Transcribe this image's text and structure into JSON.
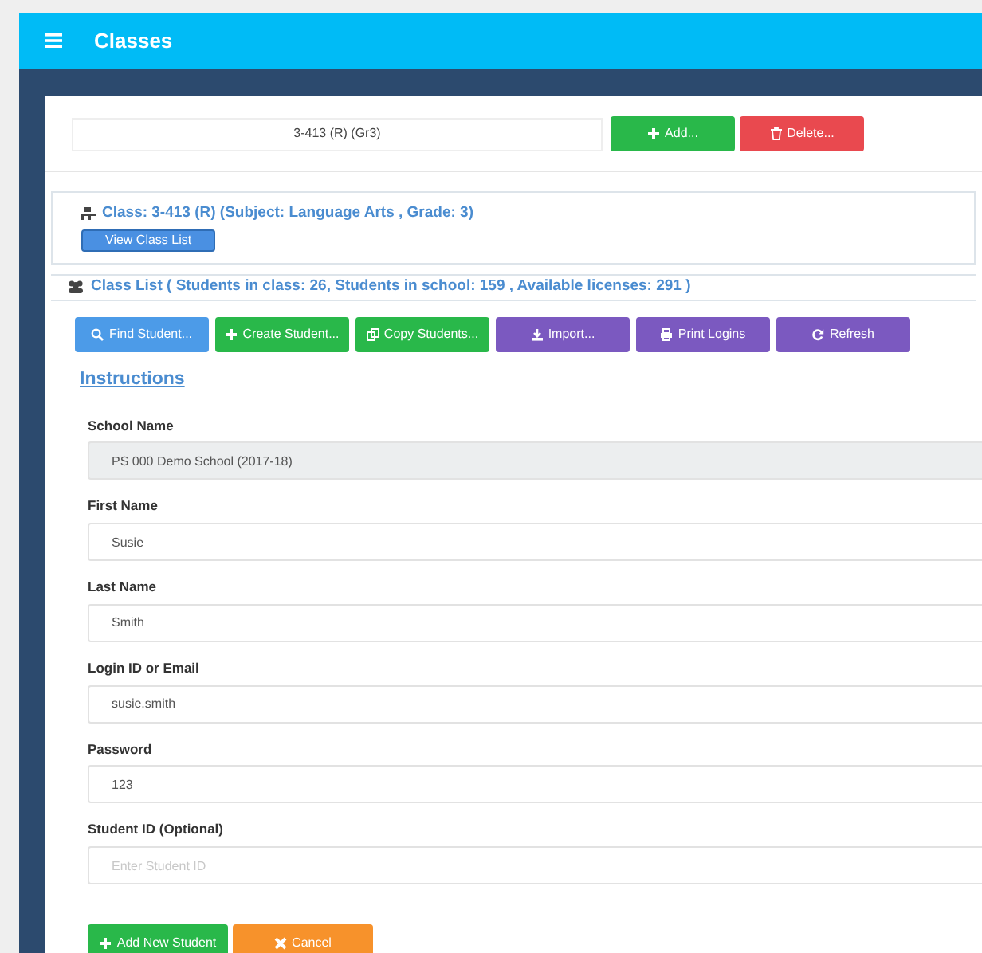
{
  "app_bar": {
    "title": "Classes"
  },
  "class_picker": {
    "value": "3-413 (R) (Gr3)",
    "buttons": [
      {
        "label": "Add...",
        "kind": "success"
      },
      {
        "label": "Delete...",
        "kind": "danger"
      }
    ]
  },
  "class_panel": {
    "heading": "Class: 3-413 (R) (Subject: Language Arts , Grade: 3)",
    "button": "View Class List"
  },
  "class_list": {
    "heading": "Class List ( Students in class: 26, Students in school: 159 , Available licenses: 291 )",
    "toolbar": [
      {
        "label": "Find Student...",
        "kind": "info"
      },
      {
        "label": "Create Student...",
        "kind": "success"
      },
      {
        "label": "Copy Students...",
        "kind": "success"
      },
      {
        "label": "Import...",
        "kind": "primary"
      },
      {
        "label": "Print Logins",
        "kind": "primary"
      },
      {
        "label": "Refresh",
        "kind": "primary"
      }
    ],
    "instructions_link": "Instructions"
  },
  "form": {
    "fields": [
      {
        "label": "School Name",
        "value": "PS 000 Demo School (2017-18)",
        "disabled": true
      },
      {
        "label": "First Name",
        "value": "Susie",
        "disabled": false
      },
      {
        "label": "Last Name",
        "value": "Smith",
        "disabled": false
      },
      {
        "label": "Login ID or Email",
        "value": "susie.smith",
        "disabled": false
      },
      {
        "label": "Password",
        "value": "123",
        "disabled": false
      },
      {
        "label": "Student ID (Optional)",
        "placeholder": "Enter Student ID",
        "disabled": false
      }
    ],
    "buttons": [
      {
        "label": "Add New Student",
        "kind": "success"
      },
      {
        "label": "Cancel",
        "kind": "warning"
      }
    ]
  }
}
